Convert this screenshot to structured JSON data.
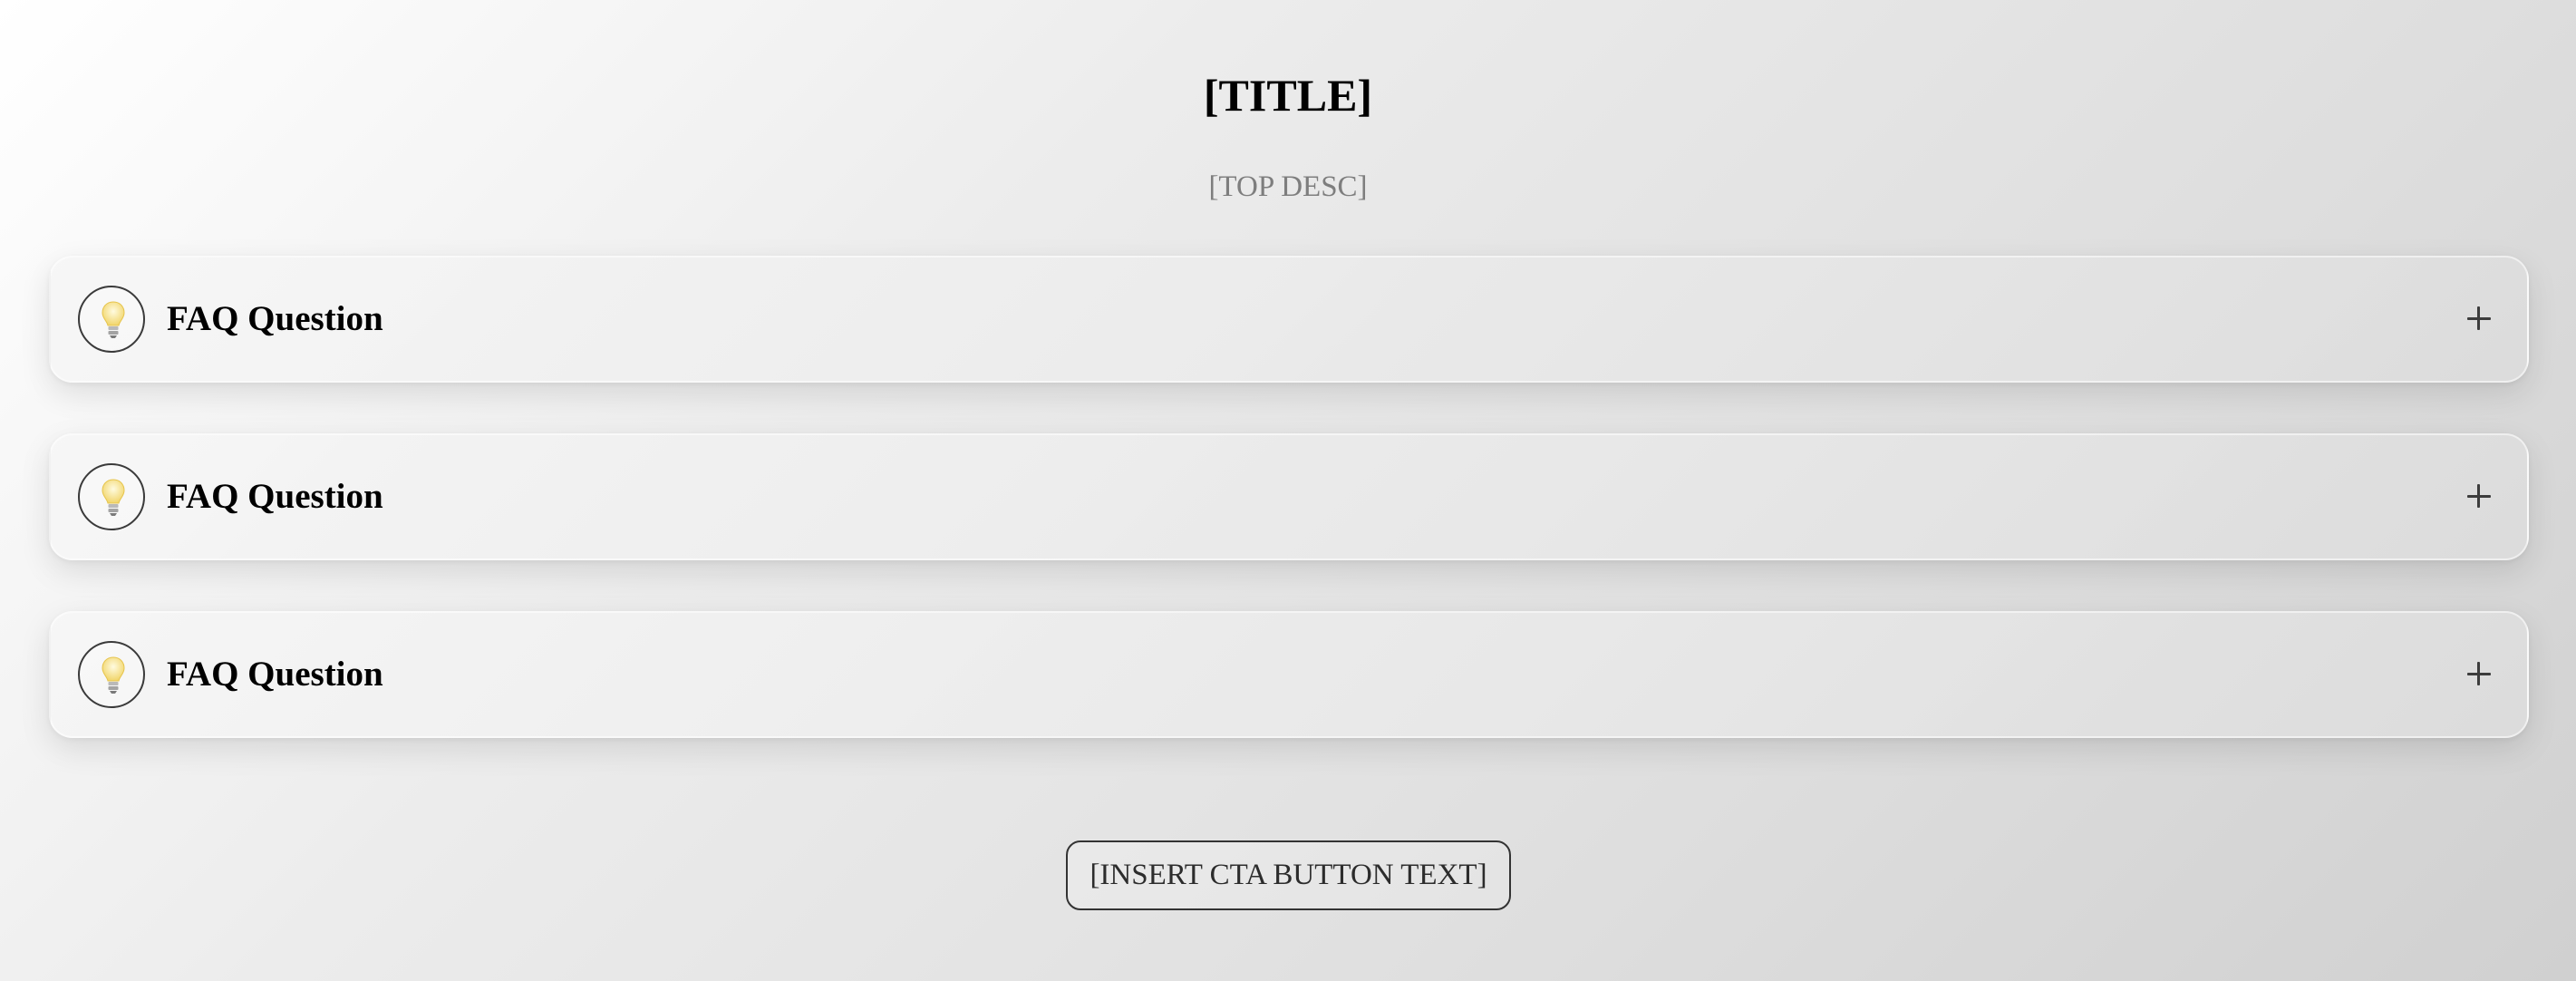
{
  "header": {
    "title": "[TITLE]",
    "description": "[TOP DESC]"
  },
  "faq": {
    "items": [
      {
        "question": "FAQ Question",
        "icon": "lightbulb-icon",
        "toggle_icon": "plus-icon"
      },
      {
        "question": "FAQ Question",
        "icon": "lightbulb-icon",
        "toggle_icon": "plus-icon"
      },
      {
        "question": "FAQ Question",
        "icon": "lightbulb-icon",
        "toggle_icon": "plus-icon"
      }
    ]
  },
  "cta": {
    "label": "[INSERT CTA BUTTON TEXT]"
  },
  "colors": {
    "title": "#000000",
    "description": "#7e7e7e",
    "icon_bulb": "#f3dc7a",
    "border": "#333333"
  }
}
